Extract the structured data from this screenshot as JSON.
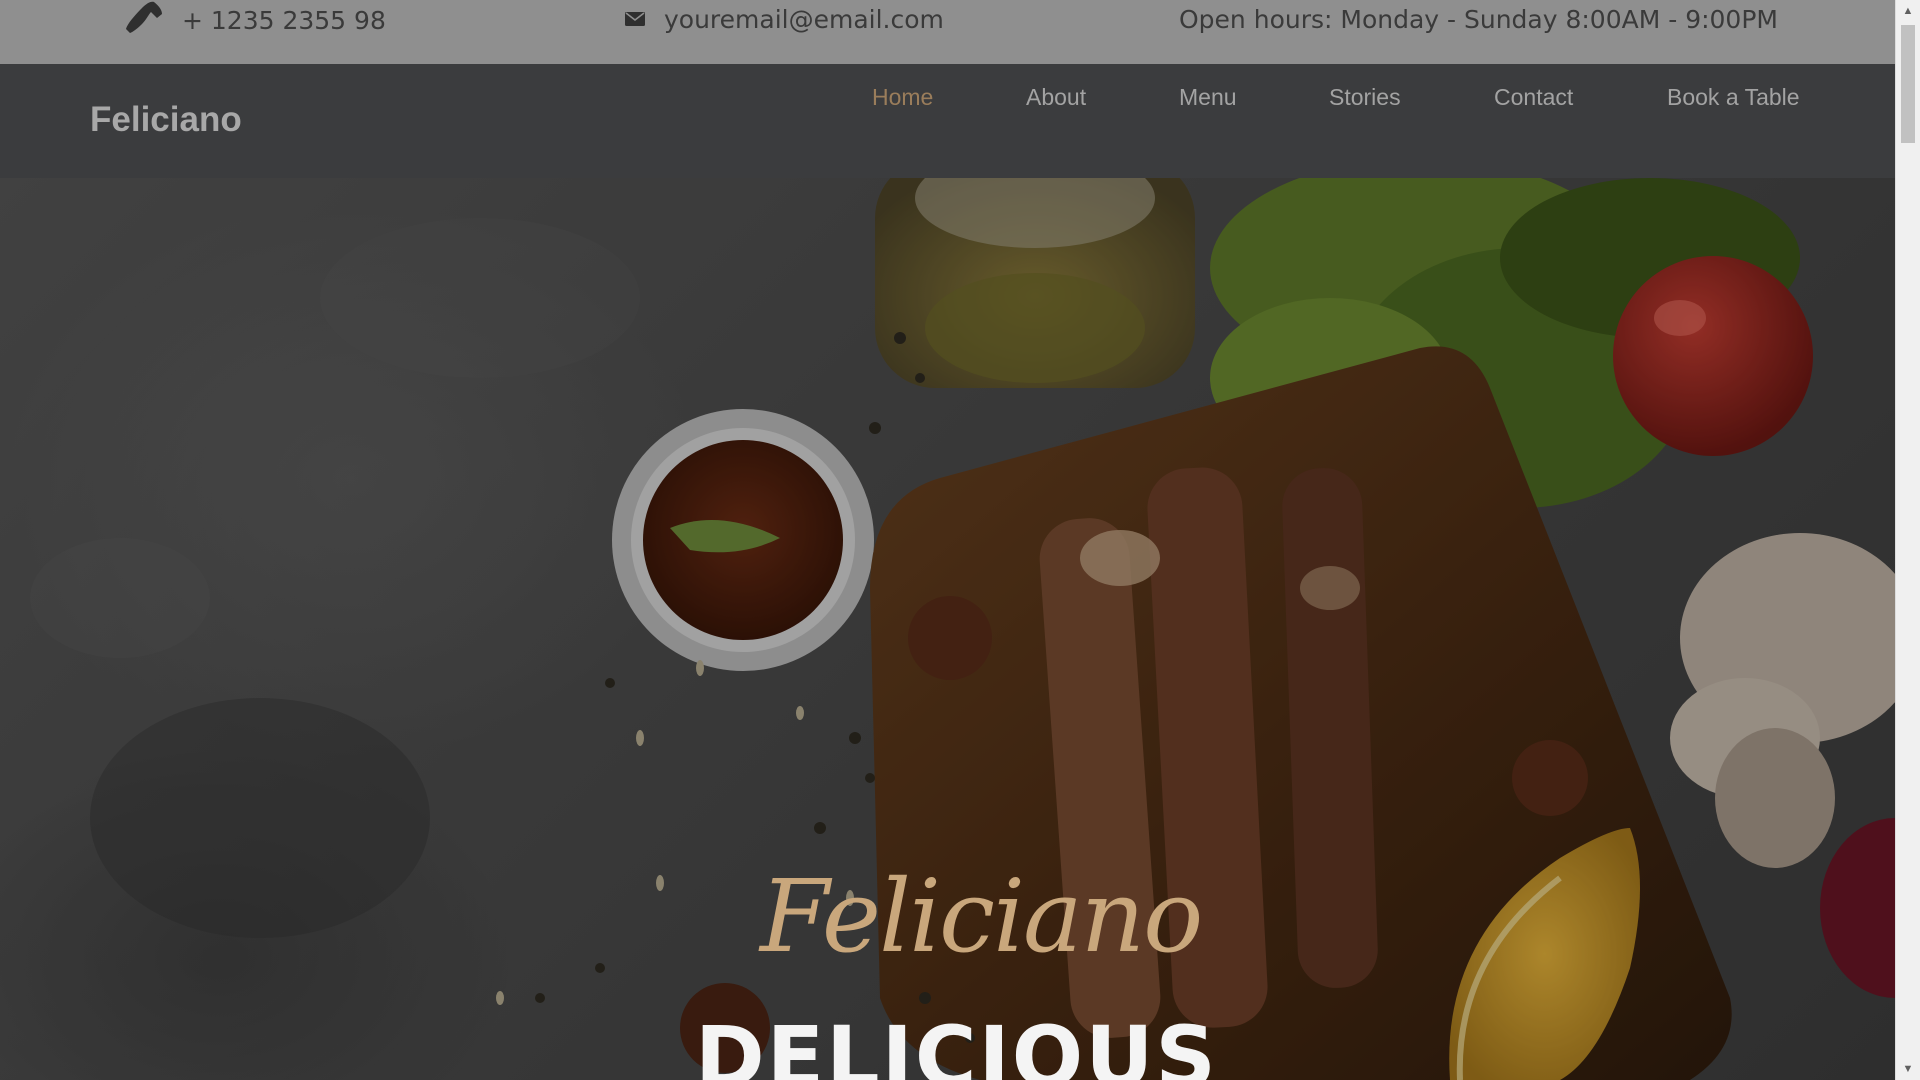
{
  "topbar": {
    "phone": "+ 1235 2355 98",
    "email": "youremail@email.com",
    "hours": "Open hours: Monday - Sunday 8:00AM - 9:00PM",
    "phone_icon": "phone-icon",
    "email_icon": "envelope-icon"
  },
  "navbar": {
    "brand": "Feliciano",
    "items": [
      {
        "label": "Home",
        "active": true
      },
      {
        "label": "About"
      },
      {
        "label": "Menu"
      },
      {
        "label": "Stories"
      },
      {
        "label": "Contact"
      },
      {
        "label": "Book a Table"
      }
    ]
  },
  "hero": {
    "script_title": "Feliciano",
    "title": "DELICIOUS"
  },
  "colors": {
    "accent": "#9a7d5b",
    "script": "#c9a77c",
    "navbar_bg": "#3b3c3e",
    "topbar_bg": "#8f8f8f"
  }
}
